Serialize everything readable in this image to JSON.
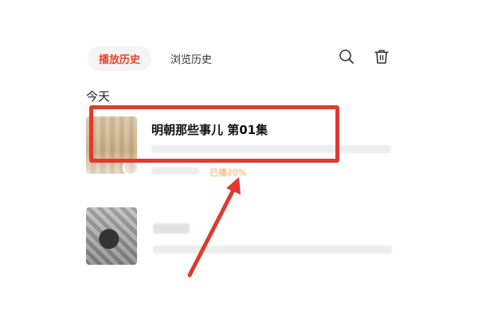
{
  "tabs": [
    {
      "label": "播放历史",
      "active": true
    },
    {
      "label": "浏览历史",
      "active": false
    }
  ],
  "section_label": "今天",
  "items": [
    {
      "title": "明朝那些事儿 第01集",
      "progress": "已播20%"
    },
    {
      "title": ""
    }
  ],
  "colors": {
    "accent": "#e8472b",
    "highlight": "#e03a2e",
    "progress": "#f0a050"
  },
  "icons": [
    "search-icon",
    "trash-icon"
  ]
}
